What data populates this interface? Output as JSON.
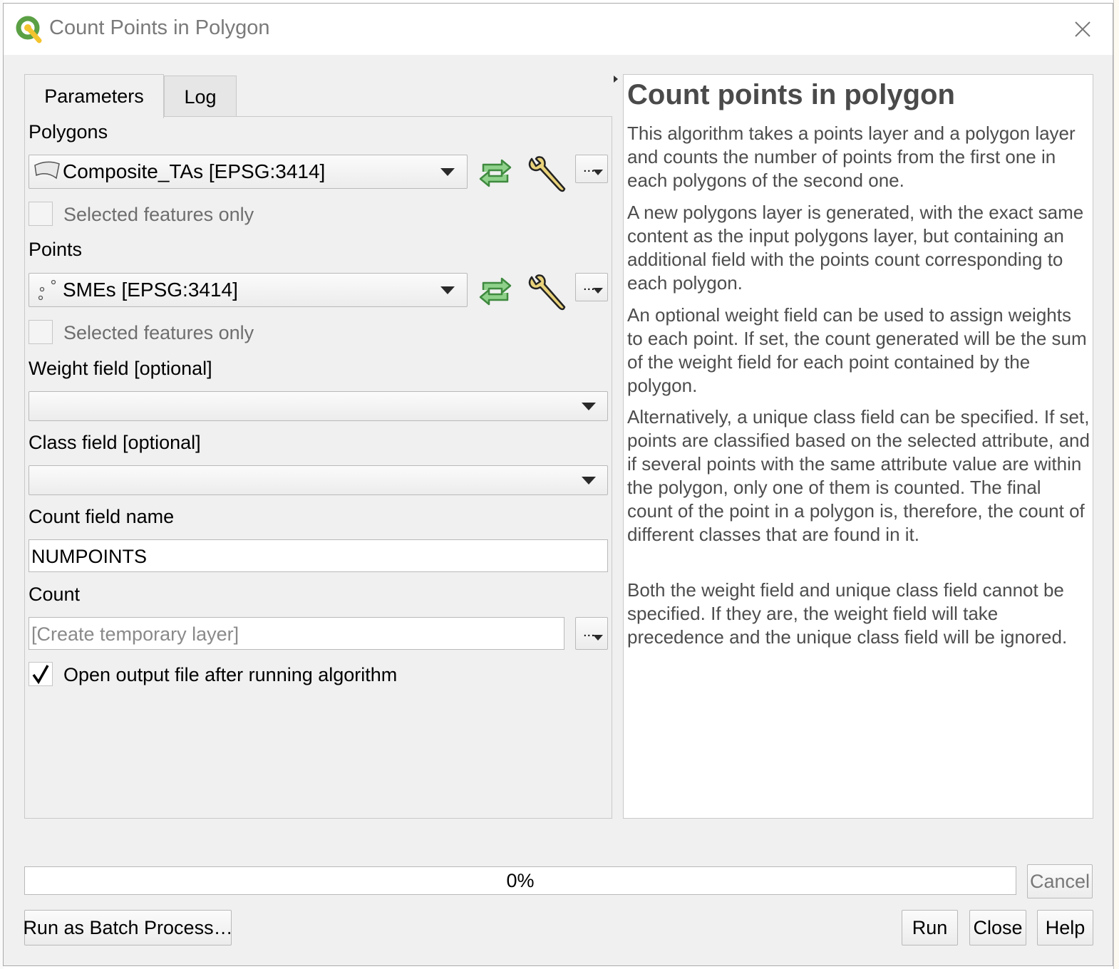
{
  "window": {
    "title": "Count Points in Polygon"
  },
  "tabs": [
    {
      "label": "Parameters"
    },
    {
      "label": "Log"
    }
  ],
  "params": {
    "polygons": {
      "label": "Polygons",
      "value": "Composite_TAs [EPSG:3414]",
      "selected_only_label": "Selected features only",
      "selected_only_checked": false
    },
    "points": {
      "label": "Points",
      "value": "SMEs [EPSG:3414]",
      "selected_only_label": "Selected features only",
      "selected_only_checked": false
    },
    "weight": {
      "label": "Weight field [optional]",
      "value": ""
    },
    "class": {
      "label": "Class field [optional]",
      "value": ""
    },
    "count_field": {
      "label": "Count field name",
      "value": "NUMPOINTS"
    },
    "count": {
      "label": "Count",
      "placeholder": "[Create temporary layer]"
    },
    "open_output": {
      "label": "Open output file after running algorithm",
      "checked": true
    },
    "dots_label": "..."
  },
  "help": {
    "title": "Count points in polygon",
    "paragraphs": [
      "This algorithm takes a points layer and a polygon layer and counts the number of points from the first one in each polygons of the second one.",
      "A new polygons layer is generated, with the exact same content as the input polygons layer, but containing an additional field with the points count corresponding to each polygon.",
      "An optional weight field can be used to assign weights to each point. If set, the count generated will be the sum of the weight field for each point contained by the polygon.",
      "Alternatively, a unique class field can be specified. If set, points are classified based on the selected attribute, and if several points with the same attribute value are within the polygon, only one of them is counted. The final count of the point in a polygon is, therefore, the count of different classes that are found in it.",
      "Both the weight field and unique class field cannot be specified. If they are, the weight field will take precedence and the unique class field will be ignored."
    ]
  },
  "progress": {
    "text": "0%",
    "value": 0
  },
  "buttons": {
    "cancel": "Cancel",
    "batch": "Run as Batch Process…",
    "run": "Run",
    "close": "Close",
    "help": "Help"
  },
  "icons": {
    "app": "qgis-logo-icon",
    "refresh": "iterate-features-icon",
    "wrench": "advanced-options-icon",
    "polygon": "polygon-layer-icon",
    "point": "point-layer-icon"
  },
  "colors": {
    "refresh_green": "#5aa55a",
    "title_gray": "#7a7a7a",
    "help_text": "#4d4d4d"
  }
}
